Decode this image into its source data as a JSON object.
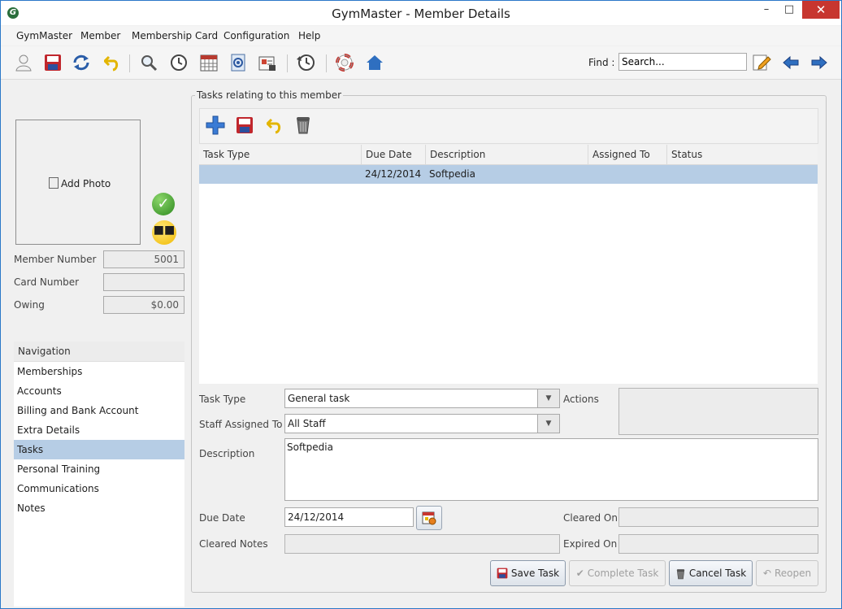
{
  "window": {
    "title": "GymMaster - Member Details",
    "minimize": "–",
    "maximize": "□",
    "close": "✕"
  },
  "menu": [
    "GymMaster",
    "Member",
    "Membership Card",
    "Configuration",
    "Help"
  ],
  "toolbar": {
    "icons": [
      "person-icon",
      "save-icon",
      "refresh-icon",
      "undo-icon",
      "search-icon",
      "clock-icon",
      "calendar-icon",
      "email-icon",
      "card-icon",
      "history-icon",
      "lifebuoy-icon",
      "home-icon",
      "edit-icon",
      "back-arrow-icon",
      "forward-arrow-icon"
    ],
    "find_label": "Find :",
    "find_value": "Search..."
  },
  "member": {
    "add_photo": "Add Photo",
    "member_number_label": "Member Number",
    "member_number": "5001",
    "card_number_label": "Card Number",
    "card_number": "",
    "owing_label": "Owing",
    "owing": "$0.00"
  },
  "navigation": {
    "header": "Navigation",
    "items": [
      "Memberships",
      "Accounts",
      "Billing and Bank Account",
      "Extra Details",
      "Tasks",
      "Personal Training",
      "Communications",
      "Notes"
    ],
    "selected": "Tasks"
  },
  "tasks": {
    "group_title": "Tasks relating to this member",
    "columns": [
      "Task Type",
      "Due Date",
      "Description",
      "Assigned To",
      "Status"
    ],
    "rows": [
      {
        "task_type": "",
        "due_date": "24/12/2014",
        "description": "Softpedia",
        "assigned_to": "",
        "status": ""
      }
    ]
  },
  "form": {
    "task_type_label": "Task Type",
    "task_type": "General task",
    "actions_label": "Actions",
    "staff_label": "Staff Assigned To",
    "staff": "All Staff",
    "description_label": "Description",
    "description": "Softpedia",
    "due_date_label": "Due Date",
    "due_date": "24/12/2014",
    "cleared_on_label": "Cleared On",
    "cleared_notes_label": "Cleared Notes",
    "expired_on_label": "Expired On"
  },
  "buttons": {
    "save": "Save Task",
    "complete": "Complete Task",
    "cancel": "Cancel Task",
    "reopen": "Reopen"
  },
  "colors": {
    "selection": "#b6cde5",
    "close_button": "#c7362f",
    "window_border": "#2b78c8"
  }
}
